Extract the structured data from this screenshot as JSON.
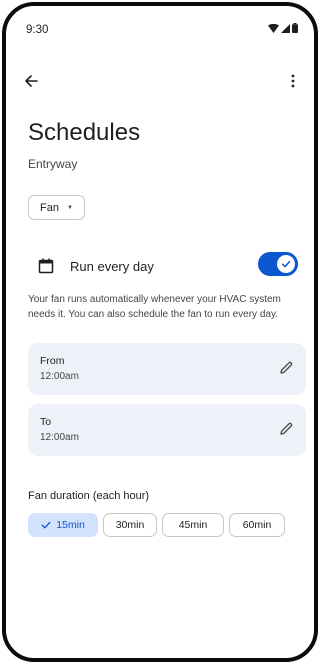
{
  "status_bar": {
    "time": "9:30",
    "icons": [
      "wifi-icon",
      "signal-icon",
      "battery-icon"
    ]
  },
  "app_bar": {
    "back_icon": "arrow-back-icon",
    "more_icon": "more-vert-icon"
  },
  "header": {
    "title": "Schedules",
    "subtitle": "Entryway"
  },
  "mode_selector": {
    "selected": "Fan",
    "icon": "dropdown-caret-icon"
  },
  "run_every_day": {
    "label": "Run every day",
    "icon": "calendar-icon",
    "enabled": true
  },
  "description": "Your fan runs automatically whenever your HVAC system needs it. You can also schedule the fan to run every day.",
  "from": {
    "label": "From",
    "value": "12:00am",
    "icon": "pencil-icon"
  },
  "to": {
    "label": "To",
    "value": "12:00am",
    "icon": "pencil-icon"
  },
  "duration": {
    "label": "Fan duration (each hour)",
    "options": [
      "15min",
      "30min",
      "45min",
      "60min"
    ],
    "selected": "15min"
  },
  "colors": {
    "accent": "#0b57d0",
    "card_bg": "#eef2f8",
    "selected_chip_bg": "#d3e3fd"
  }
}
